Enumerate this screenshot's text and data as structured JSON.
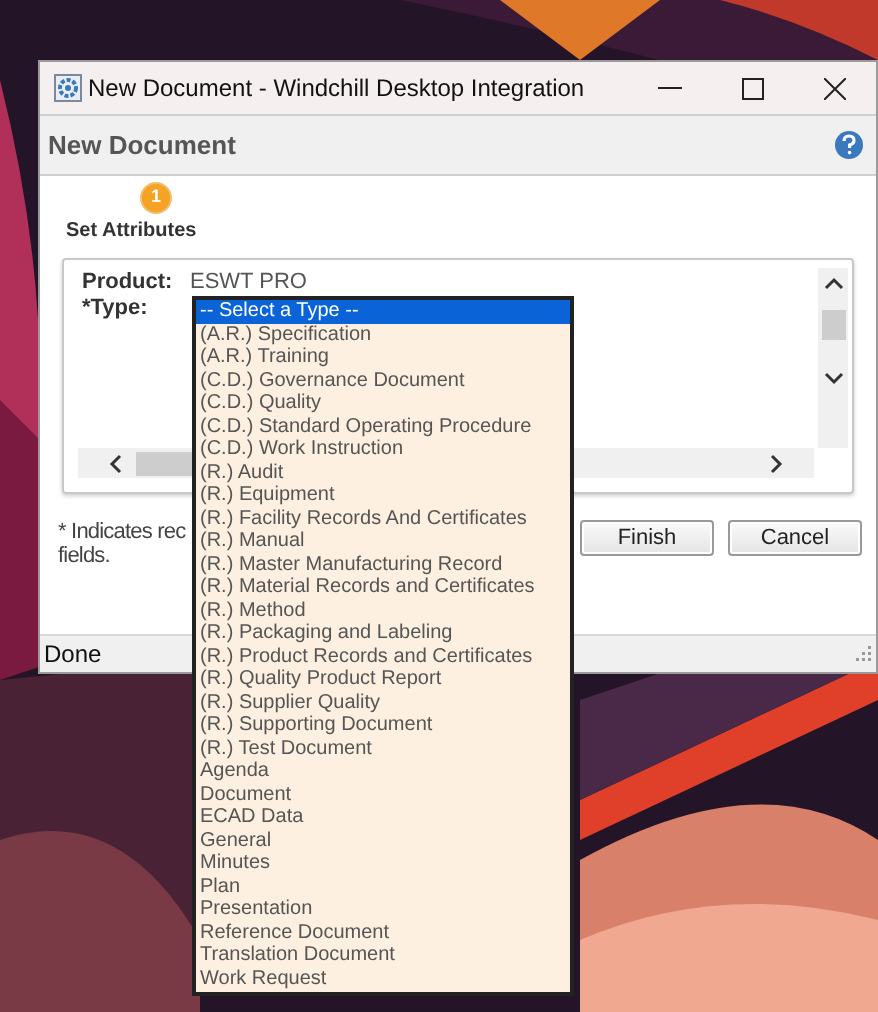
{
  "window": {
    "title": "New Document - Windchill Desktop Integration"
  },
  "header": {
    "title": "New Document"
  },
  "step": {
    "number": "1",
    "label": "Set Attributes"
  },
  "fields": [
    {
      "label": "Product:",
      "value": "ESWT PRO"
    },
    {
      "label": "*Type:"
    }
  ],
  "type_dropdown": {
    "options": [
      {
        "label": "-- Select a Type --",
        "selected": true
      },
      {
        "label": "(A.R.) Specification",
        "selected": false
      },
      {
        "label": "(A.R.) Training",
        "selected": false
      },
      {
        "label": "(C.D.) Governance Document",
        "selected": false
      },
      {
        "label": "(C.D.) Quality",
        "selected": false
      },
      {
        "label": "(C.D.) Standard Operating Procedure",
        "selected": false
      },
      {
        "label": "(C.D.) Work Instruction",
        "selected": false
      },
      {
        "label": "(R.) Audit",
        "selected": false
      },
      {
        "label": "(R.) Equipment",
        "selected": false
      },
      {
        "label": "(R.) Facility Records And Certificates",
        "selected": false
      },
      {
        "label": "(R.) Manual",
        "selected": false
      },
      {
        "label": "(R.) Master Manufacturing Record",
        "selected": false
      },
      {
        "label": "(R.) Material Records and Certificates",
        "selected": false
      },
      {
        "label": "(R.) Method",
        "selected": false
      },
      {
        "label": "(R.) Packaging and Labeling",
        "selected": false
      },
      {
        "label": "(R.) Product Records and Certificates",
        "selected": false
      },
      {
        "label": "(R.) Quality Product Report",
        "selected": false
      },
      {
        "label": "(R.) Supplier Quality",
        "selected": false
      },
      {
        "label": "(R.) Supporting Document",
        "selected": false
      },
      {
        "label": "(R.) Test Document",
        "selected": false
      },
      {
        "label": "Agenda",
        "selected": false
      },
      {
        "label": "Document",
        "selected": false
      },
      {
        "label": "ECAD Data",
        "selected": false
      },
      {
        "label": "General",
        "selected": false
      },
      {
        "label": "Minutes",
        "selected": false
      },
      {
        "label": "Plan",
        "selected": false
      },
      {
        "label": "Presentation",
        "selected": false
      },
      {
        "label": "Reference Document",
        "selected": false
      },
      {
        "label": "Translation Document",
        "selected": false
      },
      {
        "label": "Work Request",
        "selected": false
      }
    ]
  },
  "note_lines": [
    "* Indicates rec",
    "fields."
  ],
  "buttons": [
    "Finish",
    "Cancel"
  ],
  "status_bar": "Done"
}
